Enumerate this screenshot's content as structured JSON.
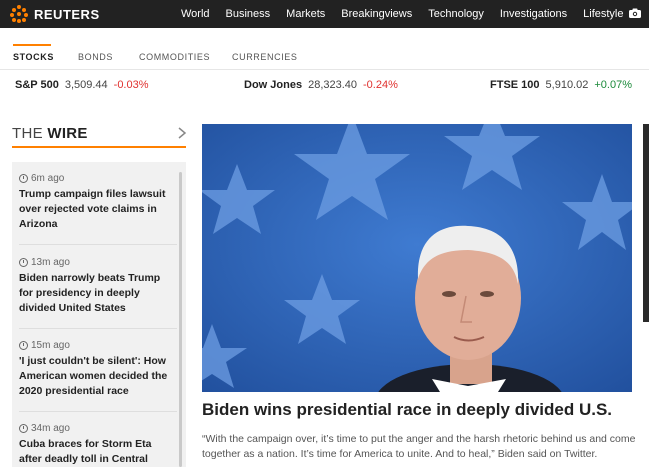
{
  "brand": {
    "name": "REUTERS",
    "accent_color": "#ff8000"
  },
  "nav": {
    "items": [
      "World",
      "Business",
      "Markets",
      "Breakingviews",
      "Technology",
      "Investigations",
      "Lifestyle"
    ],
    "camera_icon": "camera-icon"
  },
  "market_tabs": {
    "items": [
      "STOCKS",
      "BONDS",
      "COMMODITIES",
      "CURRENCIES"
    ],
    "active": "STOCKS"
  },
  "indices": [
    {
      "name": "S&P 500",
      "value": "3,509.44",
      "change": "-0.03%",
      "direction": "down"
    },
    {
      "name": "Dow Jones",
      "value": "28,323.40",
      "change": "-0.24%",
      "direction": "down"
    },
    {
      "name": "FTSE 100",
      "value": "5,910.02",
      "change": "+0.07%",
      "direction": "up"
    }
  ],
  "wire": {
    "title_prefix": "THE",
    "title_main": "WIRE",
    "items": [
      {
        "time": "6m ago",
        "headline": "Trump campaign files lawsuit over rejected vote claims in Arizona"
      },
      {
        "time": "13m ago",
        "headline": "Biden narrowly beats Trump for presidency in deeply divided United States"
      },
      {
        "time": "15m ago",
        "headline": "'I just couldn't be silent': How American women decided the 2020 presidential race"
      },
      {
        "time": "34m ago",
        "headline": "Cuba braces for Storm Eta after deadly toll in Central"
      }
    ]
  },
  "hero": {
    "headline": "Biden wins presidential race in deeply divided U.S.",
    "quote": "“With the campaign over, it’s time to put the anger and the harsh rhetoric behind us and come together as a nation. It’s time for America to unite. And to heal,” Biden said on Twitter."
  },
  "colors": {
    "negative": "#e0312f",
    "positive": "#1b8a3a",
    "topbar": "#222222"
  }
}
